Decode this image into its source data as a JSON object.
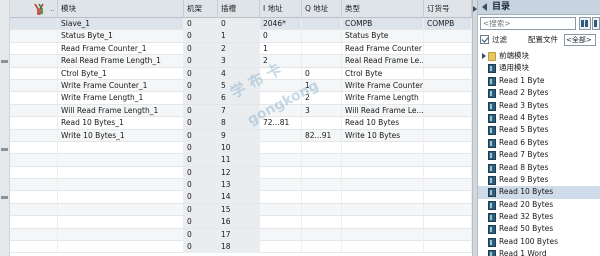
{
  "table": {
    "headers": [
      "",
      "模块",
      "机架",
      "插槽",
      "I 地址",
      "Q 地址",
      "类型",
      "订货号"
    ],
    "rows": [
      {
        "module": "Slave_1",
        "rack": "0",
        "slot": "0",
        "i_addr": "2046*",
        "q_addr": "",
        "type": "COMPB",
        "order": "COMPB",
        "selected": true
      },
      {
        "module": "Status Byte_1",
        "rack": "0",
        "slot": "1",
        "i_addr": "0",
        "q_addr": "",
        "type": "Status Byte",
        "order": ""
      },
      {
        "module": "Read Frame Counter_1",
        "rack": "0",
        "slot": "2",
        "i_addr": "1",
        "q_addr": "",
        "type": "Read Frame Counter",
        "order": ""
      },
      {
        "module": "Real Read Frame Length_1",
        "rack": "0",
        "slot": "3",
        "i_addr": "2",
        "q_addr": "",
        "type": "Real Read Frame Le...",
        "order": ""
      },
      {
        "module": "Ctrol Byte_1",
        "rack": "0",
        "slot": "4",
        "i_addr": "",
        "q_addr": "0",
        "type": "Ctrol Byte",
        "order": ""
      },
      {
        "module": "Write Frame Counter_1",
        "rack": "0",
        "slot": "5",
        "i_addr": "",
        "q_addr": "1",
        "type": "Write Frame Counter",
        "order": ""
      },
      {
        "module": "Write Frame Length_1",
        "rack": "0",
        "slot": "6",
        "i_addr": "",
        "q_addr": "2",
        "type": "Write Frame Length",
        "order": ""
      },
      {
        "module": "Will Read Frame Length_1",
        "rack": "0",
        "slot": "7",
        "i_addr": "",
        "q_addr": "3",
        "type": "Will Read Frame Le...",
        "order": ""
      },
      {
        "module": "Read 10 Bytes_1",
        "rack": "0",
        "slot": "8",
        "i_addr": "72...81",
        "q_addr": "",
        "type": "Read 10 Bytes",
        "order": ""
      },
      {
        "module": "Write 10 Bytes_1",
        "rack": "0",
        "slot": "9",
        "i_addr": "",
        "q_addr": "82...91",
        "type": "Write 10 Bytes",
        "order": ""
      },
      {
        "module": "",
        "rack": "0",
        "slot": "10",
        "i_addr": "",
        "q_addr": "",
        "type": "",
        "order": ""
      },
      {
        "module": "",
        "rack": "0",
        "slot": "11",
        "i_addr": "",
        "q_addr": "",
        "type": "",
        "order": ""
      },
      {
        "module": "",
        "rack": "0",
        "slot": "12",
        "i_addr": "",
        "q_addr": "",
        "type": "",
        "order": ""
      },
      {
        "module": "",
        "rack": "0",
        "slot": "13",
        "i_addr": "",
        "q_addr": "",
        "type": "",
        "order": ""
      },
      {
        "module": "",
        "rack": "0",
        "slot": "14",
        "i_addr": "",
        "q_addr": "",
        "type": "",
        "order": ""
      },
      {
        "module": "",
        "rack": "0",
        "slot": "15",
        "i_addr": "",
        "q_addr": "",
        "type": "",
        "order": ""
      },
      {
        "module": "",
        "rack": "0",
        "slot": "16",
        "i_addr": "",
        "q_addr": "",
        "type": "",
        "order": ""
      },
      {
        "module": "",
        "rack": "0",
        "slot": "17",
        "i_addr": "",
        "q_addr": "",
        "type": "",
        "order": ""
      },
      {
        "module": "",
        "rack": "0",
        "slot": "18",
        "i_addr": "",
        "q_addr": "",
        "type": "",
        "order": ""
      }
    ]
  },
  "watermark": {
    "line1": "学 布 卡",
    "line2": "gongkong"
  },
  "catalog": {
    "title": "目录",
    "search_placeholder": "<搜索>",
    "filter_label": "过滤",
    "profile_label": "配置文件",
    "profile_value": "<全部>",
    "items": [
      {
        "label": "前端模块",
        "kind": "folder",
        "expandable": true
      },
      {
        "label": "通用模块",
        "kind": "module"
      },
      {
        "label": "Read 1 Byte",
        "kind": "module"
      },
      {
        "label": "Read 2 Bytes",
        "kind": "module"
      },
      {
        "label": "Read 3 Bytes",
        "kind": "module"
      },
      {
        "label": "Read 4 Bytes",
        "kind": "module"
      },
      {
        "label": "Read 5 Bytes",
        "kind": "module"
      },
      {
        "label": "Read 6 Bytes",
        "kind": "module"
      },
      {
        "label": "Read 7 Bytes",
        "kind": "module"
      },
      {
        "label": "Read 8 Bytes",
        "kind": "module"
      },
      {
        "label": "Read 9 Bytes",
        "kind": "module"
      },
      {
        "label": "Read 10 Bytes",
        "kind": "module",
        "selected": true
      },
      {
        "label": "Read 20 Bytes",
        "kind": "module"
      },
      {
        "label": "Read 32 Bytes",
        "kind": "module"
      },
      {
        "label": "Read 50 Bytes",
        "kind": "module"
      },
      {
        "label": "Read 100 Bytes",
        "kind": "module"
      },
      {
        "label": "Read 1 Word",
        "kind": "module"
      }
    ]
  },
  "colors": {
    "header_bg": "#dfe4e8",
    "catalog_title_bg": "#c7d3de",
    "selection": "#cfdbe8"
  },
  "icons": {
    "filter_toggle": "y-filter-icon",
    "search": "search-icon",
    "folder": "folder-icon",
    "module": "module-icon"
  }
}
